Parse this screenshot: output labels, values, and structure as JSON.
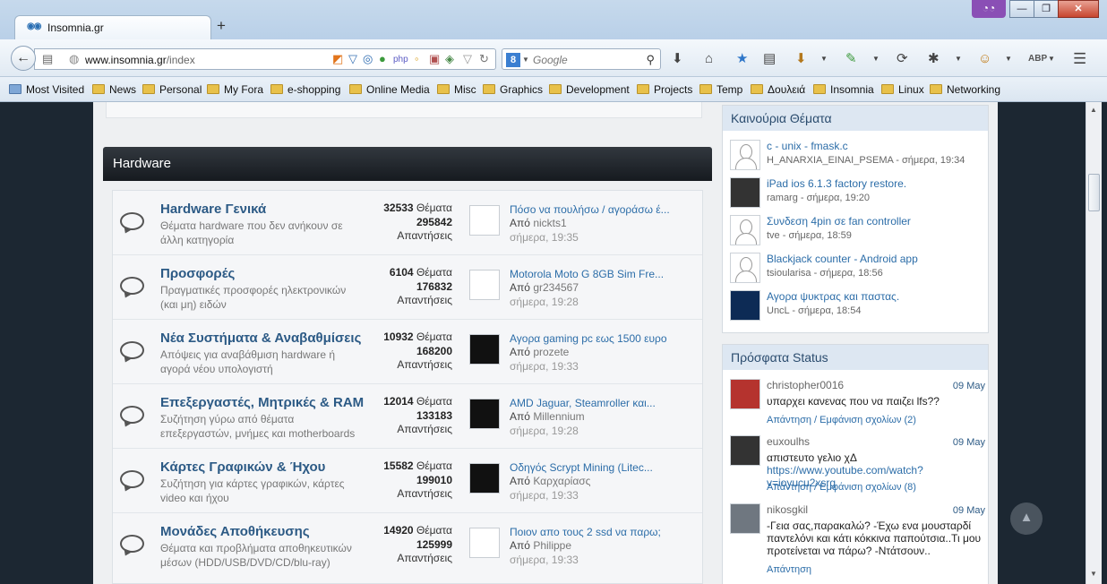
{
  "browser": {
    "tab_title": "Insomnia.gr",
    "tab_favicon": "◉◉",
    "new_tab": "+",
    "url_host": "www.insomnia.gr",
    "url_path": "/index",
    "search_engine": "8",
    "search_placeholder": "Google",
    "private_mask": "◔◔",
    "window_minimize": "—",
    "window_maximize": "❐",
    "window_close": "✕"
  },
  "bookmarks": [
    "Most Visited",
    "News",
    "Personal",
    "My Fora",
    "e-shopping",
    "Online Media",
    "Misc",
    "Graphics",
    "Development",
    "Projects",
    "Temp",
    "Δουλειά",
    "Insomnia",
    "Linux",
    "Networking"
  ],
  "section": {
    "title": "Hardware"
  },
  "forums": [
    {
      "title": "Hardware Γενικά",
      "desc": "Θέματα hardware που δεν ανήκουν σε άλλη κατηγορία",
      "topics": "32533",
      "topics_label": "Θέματα",
      "replies": "295842",
      "replies_label": "Απαντήσεις",
      "last_title": "Πόσο να πουλήσω / αγοράσω έ...",
      "by_label": "Από",
      "last_user": "nickts1",
      "last_date": "σήμερα, 19:35",
      "thumb": "light"
    },
    {
      "title": "Προσφορές",
      "desc": "Πραγματικές προσφορές ηλεκτρονικών (και μη) ειδών",
      "topics": "6104",
      "topics_label": "Θέματα",
      "replies": "176832",
      "replies_label": "Απαντήσεις",
      "last_title": "Motorola Moto G 8GB Sim Fre...",
      "by_label": "Από",
      "last_user": "gr234567",
      "last_date": "σήμερα, 19:28",
      "thumb": "light"
    },
    {
      "title": "Νέα Συστήματα & Αναβαθμίσεις",
      "desc": "Απόψεις για αναβάθμιση hardware ή αγορά νέου υπολογιστή",
      "topics": "10932",
      "topics_label": "Θέματα",
      "replies": "168200",
      "replies_label": "Απαντήσεις",
      "last_title": "Αγορα gaming pc εως 1500 ευρο",
      "by_label": "Από",
      "last_user": "prozete",
      "last_date": "σήμερα, 19:33",
      "thumb": "dark"
    },
    {
      "title": "Επεξεργαστές, Μητρικές & RAM",
      "desc": "Συζήτηση γύρω από θέματα επεξεργαστών, μνήμες και motherboards",
      "topics": "12014",
      "topics_label": "Θέματα",
      "replies": "133183",
      "replies_label": "Απαντήσεις",
      "last_title": "AMD Jaguar, Steamroller και...",
      "by_label": "Από",
      "last_user": "Millennium",
      "last_date": "σήμερα, 19:28",
      "thumb": "dark"
    },
    {
      "title": "Κάρτες Γραφικών & Ήχου",
      "desc": "Συζήτηση για κάρτες γραφικών, κάρτες video και ήχου",
      "topics": "15582",
      "topics_label": "Θέματα",
      "replies": "199010",
      "replies_label": "Απαντήσεις",
      "last_title": "Οδηγός Scrypt Mining (Litec...",
      "by_label": "Από",
      "last_user": "Καρχαρίασς",
      "last_date": "σήμερα, 19:33",
      "thumb": "dark"
    },
    {
      "title": "Μονάδες Αποθήκευσης",
      "desc": "Θέματα και προβλήματα αποθηκευτικών μέσων (HDD/USB/DVD/CD/blu-ray)",
      "topics": "14920",
      "topics_label": "Θέματα",
      "replies": "125999",
      "replies_label": "Απαντήσεις",
      "last_title": "Ποιον απο τους 2 ssd να παρω;",
      "by_label": "Από",
      "last_user": "Philippe",
      "last_date": "σήμερα, 19:33",
      "thumb": "light"
    }
  ],
  "new_topics": {
    "title": "Καινούρια Θέματα",
    "items": [
      {
        "title": "c - unix - fmask.c",
        "meta": "H_ANARXIA_EINAI_PSEMA - σήμερα, 19:34",
        "avatar": "light"
      },
      {
        "title": "iPad ios 6.1.3 factory restore.",
        "meta": "ramarg - σήμερα, 19:20",
        "avatar": "dark"
      },
      {
        "title": "Συνδεση 4pin σε fan controller",
        "meta": "tve - σήμερα, 18:59",
        "avatar": "light"
      },
      {
        "title": "Blackjack counter - Android app",
        "meta": "tsioularisa - σήμερα, 18:56",
        "avatar": "light"
      },
      {
        "title": "Αγορα ψυκτρας και παστας.",
        "meta": "UncL - σήμερα, 18:54",
        "avatar": "blue"
      }
    ]
  },
  "recent_status": {
    "title": "Πρόσφατα Status",
    "items": [
      {
        "user": "christopher0016",
        "date": "09 May",
        "text": "υπαρχει κανενας που να παιζει lfs??",
        "link": "",
        "footer": "Απάντηση / Εμφάνιση σχολίων (2)"
      },
      {
        "user": "euxoulhs",
        "date": "09 May",
        "text": "απιστευτο γελιο χΔ ",
        "link": "https://www.youtube.com/watch?v=ioyucu2xsrg",
        "footer": "Απάντηση / Εμφάνιση σχολίων (8)"
      },
      {
        "user": "nikosgkil",
        "date": "09 May",
        "text": "-Γεια σας,παρακαλώ? -Έχω ενα μουσταρδί παντελόνι και κάτι κόκκινα παπούτσια..Τι μου προτείνεται να πάρω? -Ντάτσουν..",
        "link": "",
        "footer": "Απάντηση"
      }
    ]
  },
  "scroll_top": "▲"
}
